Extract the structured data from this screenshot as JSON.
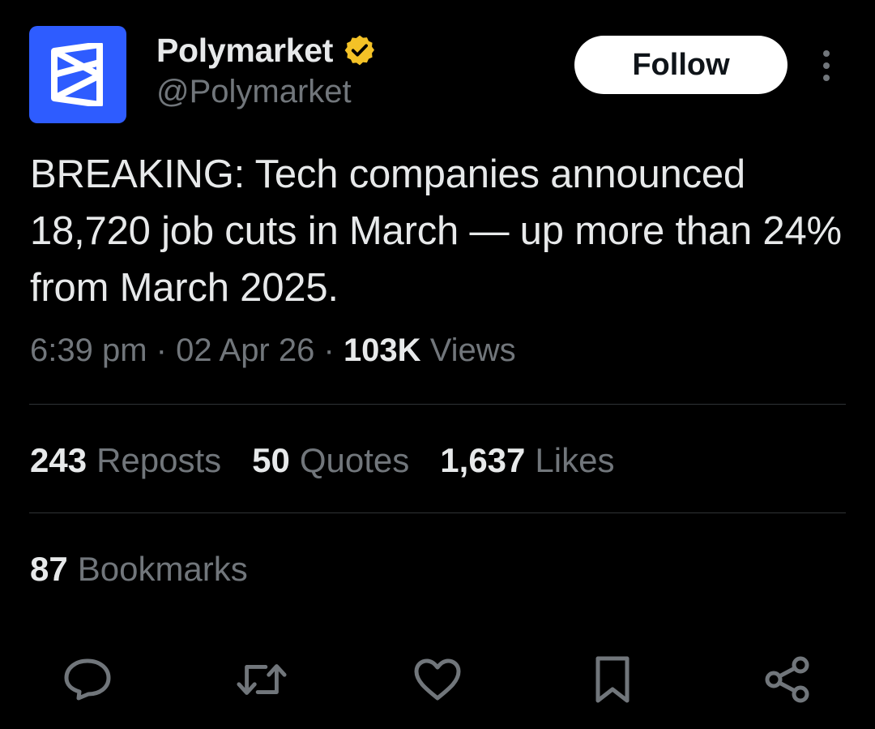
{
  "author": {
    "display_name": "Polymarket",
    "handle": "@Polymarket",
    "verified": true,
    "avatar_icon": "polymarket-logo-icon",
    "avatar_color": "#2e5cff",
    "badge_color": "#f4c227"
  },
  "header": {
    "follow_label": "Follow",
    "more_icon": "more-vertical-icon"
  },
  "tweet": {
    "text": "BREAKING: Tech companies announced 18,720 job cuts in March — up more than 24% from March 2025.",
    "time": "6:39 pm",
    "date": "02 Apr 26",
    "separator": "·",
    "views_count": "103K",
    "views_label": "Views"
  },
  "stats": {
    "reposts_count": "243",
    "reposts_label": "Reposts",
    "quotes_count": "50",
    "quotes_label": "Quotes",
    "likes_count": "1,637",
    "likes_label": "Likes",
    "bookmarks_count": "87",
    "bookmarks_label": "Bookmarks"
  },
  "actions": [
    {
      "icon": "reply-icon"
    },
    {
      "icon": "repost-icon"
    },
    {
      "icon": "like-icon"
    },
    {
      "icon": "bookmark-icon"
    },
    {
      "icon": "share-icon"
    }
  ],
  "colors": {
    "background": "#000000",
    "text_primary": "#e7e9ea",
    "text_secondary": "#71767b",
    "divider": "#2f3336",
    "icon": "#71767b"
  }
}
